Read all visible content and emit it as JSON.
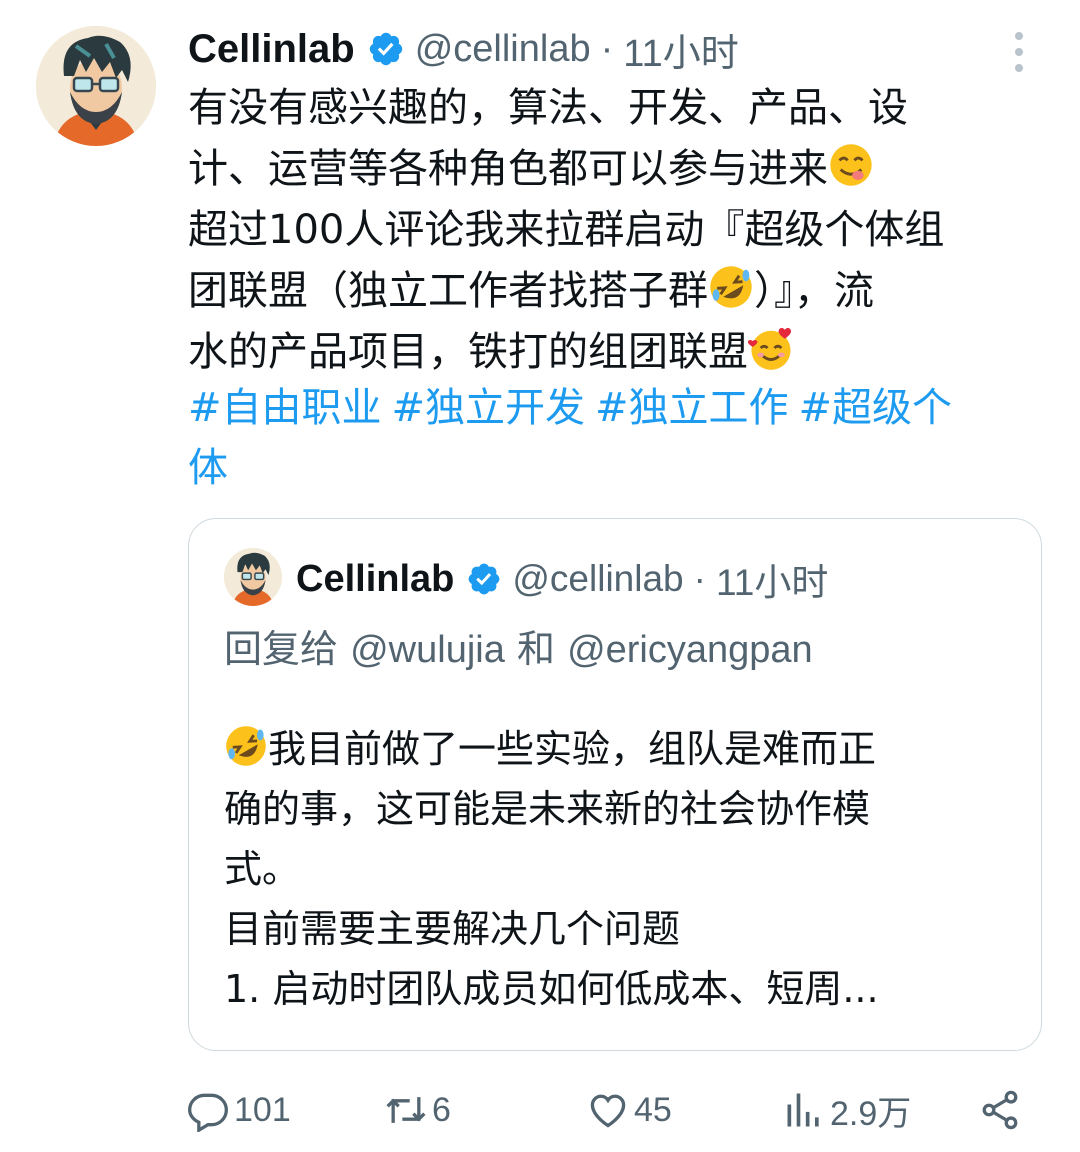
{
  "tweet": {
    "author_name": "Cellinlab",
    "handle": "@cellinlab",
    "separator": "·",
    "time": "11小时",
    "text_lines": [
      "有没有感兴趣的，算法、开发、产品、设",
      "计、运营等各种角色都可以参与进来",
      "超过100人评论我来拉群启动『超级个体组",
      "团联盟（独立工作者找搭子群",
      "）』，流",
      "水的产品项目，铁打的组团联盟"
    ],
    "hashtags": [
      "#自由职业",
      "#独立开发",
      "#独立工作",
      "#超级个",
      "体"
    ]
  },
  "quote": {
    "author_name": "Cellinlab",
    "handle": "@cellinlab",
    "separator": "·",
    "time": "11小时",
    "reply_prefix": "回复给",
    "reply_user1": "@wulujia",
    "reply_and": "和",
    "reply_user2": "@ericyangpan",
    "text_lines": [
      "我目前做了一些实验，组队是难而正",
      "确的事，这可能是未来新的社会协作模",
      "式。",
      "目前需要主要解决几个问题",
      "1. 启动时团队成员如何低成本、短周..."
    ]
  },
  "actions": {
    "replies": "101",
    "retweets": "6",
    "likes": "45",
    "views": "2.9万"
  },
  "colors": {
    "link": "#1d9bf0",
    "secondary": "#536471",
    "verified": "#1d9bf0"
  }
}
